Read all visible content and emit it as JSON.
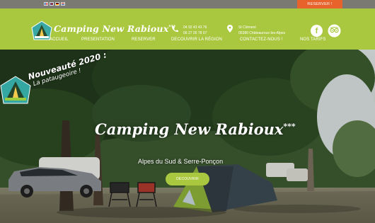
{
  "topbar": {
    "languages": [
      "fr",
      "en",
      "de",
      "nl"
    ],
    "reserve_label": "RESERVER !"
  },
  "header": {
    "brand": "Camping New Rabioux",
    "brand_stars": "***",
    "phone_1": "04 92 43 43 76",
    "phone_2": "06 27 26 78 07",
    "address_1": "St Clément",
    "address_2": "05380 Châteauroux-les-Alpes",
    "facebook_glyph": "f"
  },
  "nav": {
    "items": [
      {
        "label": "ACCUEIL"
      },
      {
        "label": "PRESENTATION"
      },
      {
        "label": "RESERVER"
      },
      {
        "label": "DECOUVRIR LA RÉGION"
      },
      {
        "label": "CONTACTEZ-NOUS !"
      },
      {
        "label": "NOS TARIFS"
      }
    ]
  },
  "hero": {
    "promo_title": "Nouveauté 2020 :",
    "promo_sub": "La pataugeoire !",
    "title": "Camping New Rabioux",
    "title_stars": "***",
    "subtitle": "Alpes du Sud & Serre-Ponçon",
    "cta_label": "DECOUVRIR"
  },
  "colors": {
    "header_green": "#a9c83f",
    "reserve_orange": "#e8622c"
  }
}
